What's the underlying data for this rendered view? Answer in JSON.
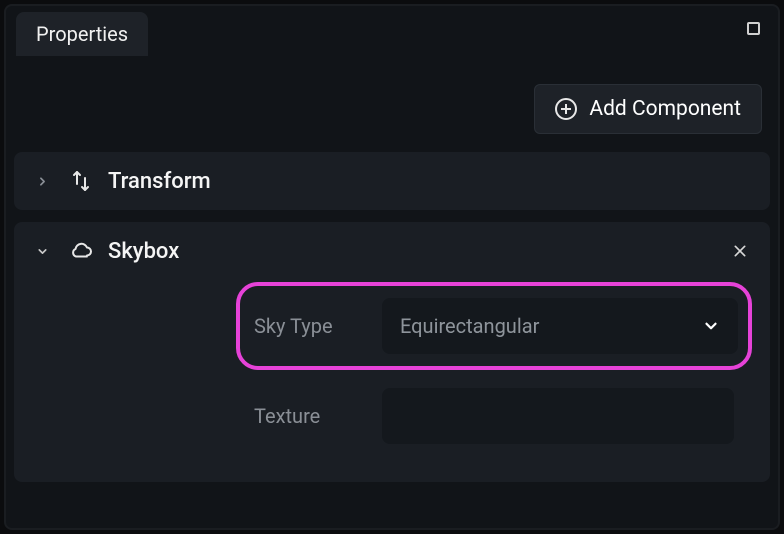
{
  "tabs": {
    "properties_label": "Properties"
  },
  "toolbar": {
    "add_component_label": "Add Component"
  },
  "components": [
    {
      "id": "transform",
      "title": "Transform",
      "expanded": false,
      "removable": false
    },
    {
      "id": "skybox",
      "title": "Skybox",
      "expanded": true,
      "removable": true,
      "fields": {
        "sky_type": {
          "label": "Sky Type",
          "value": "Equirectangular"
        },
        "texture": {
          "label": "Texture",
          "value": ""
        }
      }
    }
  ]
}
